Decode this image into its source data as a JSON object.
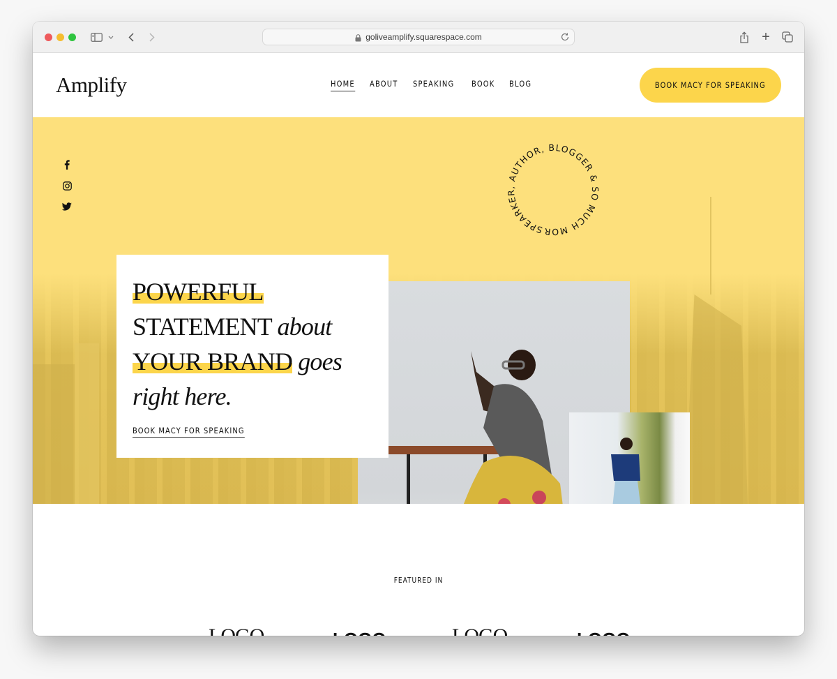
{
  "browser": {
    "url": "goliveamplify.squarespace.com",
    "icons": [
      "sidebar-toggle-icon",
      "chevron-down-icon",
      "back-arrow-icon",
      "forward-arrow-icon",
      "lock-icon",
      "reload-icon",
      "share-icon",
      "new-tab-icon",
      "tab-overview-icon"
    ],
    "new_tab_glyph": "+"
  },
  "header": {
    "logo": "Amplify",
    "nav": [
      {
        "label": "HOME",
        "active": true
      },
      {
        "label": "ABOUT",
        "active": false
      },
      {
        "label": "SPEAKING",
        "active": false
      },
      {
        "label": "BOOK",
        "active": false
      },
      {
        "label": "BLOG",
        "active": false
      }
    ],
    "cta_label": "BOOK MACY FOR SPEAKING"
  },
  "hero": {
    "social": [
      "facebook-icon",
      "instagram-icon",
      "twitter-icon"
    ],
    "headline": {
      "line1_highlight": "POWERFUL",
      "line2_plain": "STATEMENT",
      "line2_italic": "about",
      "line3_highlight": "YOUR BRAND",
      "line3_italic": "goes",
      "line4_italic": "right here."
    },
    "link_label": "BOOK MACY FOR SPEAKING",
    "circle_text": "SPEARKER, AUTHOR, BLOGGER & SO MUCH MORE."
  },
  "featured": {
    "label": "FEATURED IN",
    "logos": [
      "LOGO",
      "LOGO",
      "LOGO",
      "LOGO"
    ]
  },
  "colors": {
    "accent_yellow": "#fcd54b",
    "hero_background": "#fde07c",
    "text": "#111111"
  }
}
